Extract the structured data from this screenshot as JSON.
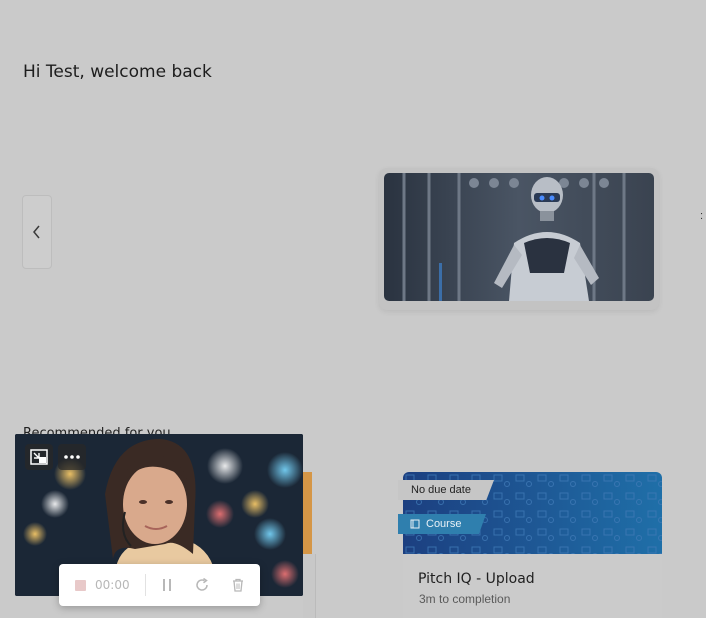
{
  "header": {
    "greeting": "Hi Test, welcome back"
  },
  "carousel": {
    "prev_icon": "chevron-left-icon"
  },
  "recommended": {
    "heading": "Recommended for you"
  },
  "course_card": {
    "due_tag": "No due date",
    "type_tag": "Course",
    "type_icon": "book-icon",
    "title": "Pitch IQ - Upload",
    "meta": "3m to completion",
    "colors": {
      "banner": "#1f4f8a",
      "tag": "#2f7fae"
    }
  },
  "pip": {
    "exit_pip_icon": "exit-picture-in-picture-icon",
    "more_icon": "more-horizontal-icon"
  },
  "recorder": {
    "time": "00:00",
    "stop_icon": "stop-icon",
    "pause_icon": "pause-icon",
    "restart_icon": "restart-icon",
    "delete_icon": "trash-icon"
  }
}
